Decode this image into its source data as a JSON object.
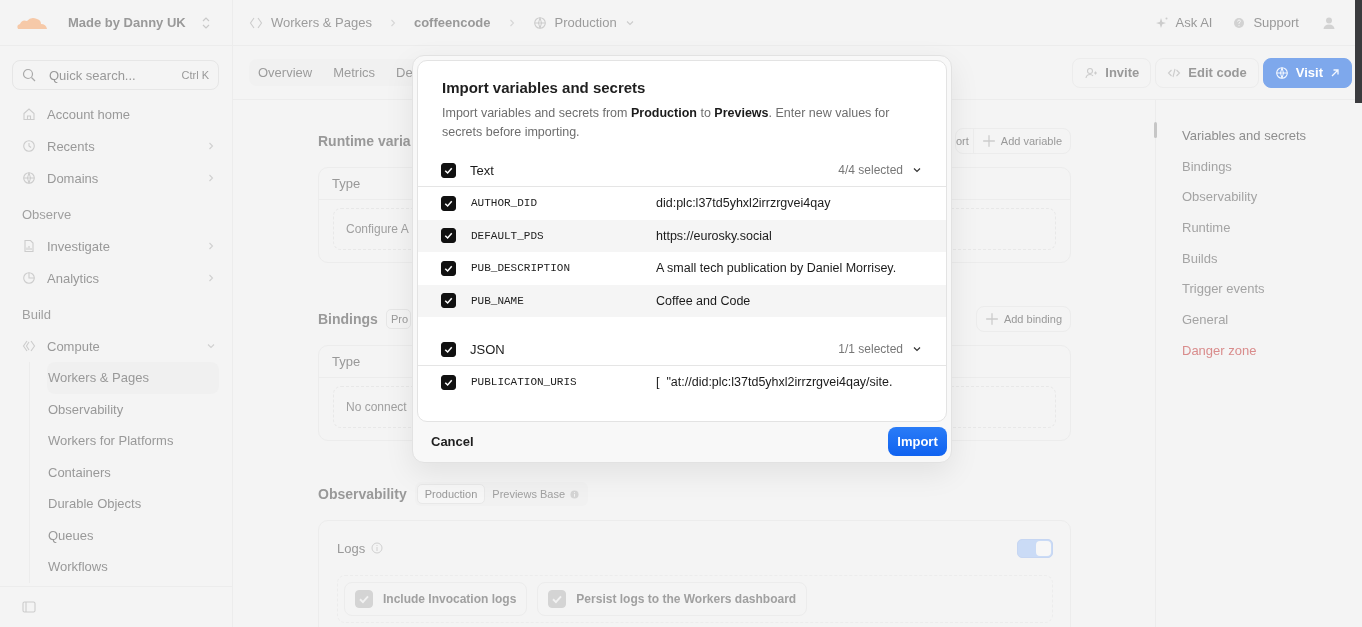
{
  "sidebar": {
    "account": "Made by Danny UK",
    "search": {
      "placeholder": "Quick search...",
      "shortcut": "Ctrl K"
    },
    "sections": [
      {
        "items": [
          {
            "label": "Account home"
          },
          {
            "label": "Recents",
            "expanded": false
          },
          {
            "label": "Domains",
            "expanded": false
          }
        ]
      },
      {
        "title": "Observe",
        "items": [
          {
            "label": "Investigate",
            "expanded": false
          },
          {
            "label": "Analytics",
            "expanded": false
          }
        ]
      },
      {
        "title": "Build",
        "items": [
          {
            "label": "Compute",
            "expanded": true,
            "children": [
              {
                "label": "Workers & Pages",
                "selected": true
              },
              {
                "label": "Observability",
                "selected": false
              },
              {
                "label": "Workers for Platforms",
                "selected": false
              },
              {
                "label": "Containers",
                "selected": false
              },
              {
                "label": "Durable Objects",
                "selected": false
              },
              {
                "label": "Queues",
                "selected": false
              },
              {
                "label": "Workflows",
                "selected": false
              }
            ]
          }
        ]
      }
    ]
  },
  "topbar": {
    "breadcrumb": [
      {
        "label": "Workers & Pages",
        "kind": "link"
      },
      {
        "label": "coffeencode",
        "kind": "current"
      },
      {
        "label": "Production",
        "kind": "dropdown"
      }
    ],
    "actions": [
      {
        "label": "Ask AI",
        "kind": "ai"
      },
      {
        "label": "Support",
        "kind": "help"
      }
    ]
  },
  "tabs": [
    "Overview",
    "Metrics",
    "De"
  ],
  "header_buttons": [
    {
      "label": "Invite",
      "kind": "invite"
    },
    {
      "label": "Edit code",
      "kind": "code"
    },
    {
      "label": "Visit",
      "kind": "primary"
    }
  ],
  "runtime": {
    "title": "Runtime varia",
    "actions": [
      {
        "label": "ort",
        "kind": "plain"
      },
      {
        "label": "Add variable",
        "kind": "add"
      }
    ],
    "table": {
      "column": "Type",
      "empty": "Configure A"
    }
  },
  "bindings": {
    "title": "Bindings",
    "badge": "Pro",
    "actions": [
      {
        "label": "Add binding",
        "kind": "add"
      }
    ],
    "table": {
      "column": "Type",
      "empty": "No connect"
    }
  },
  "observability": {
    "title": "Observability",
    "environments": [
      {
        "label": "Production",
        "selected": true,
        "info": false
      },
      {
        "label": "Previews Base",
        "selected": false,
        "info": true
      }
    ],
    "logs": {
      "title": "Logs",
      "enabled": true,
      "options": [
        {
          "label": "Include Invocation logs",
          "checked": true
        },
        {
          "label": "Persist logs to the Workers dashboard",
          "checked": true
        }
      ]
    }
  },
  "right_nav": [
    {
      "label": "Variables and secrets",
      "selected": true,
      "kind": "normal"
    },
    {
      "label": "Bindings",
      "selected": false,
      "kind": "normal"
    },
    {
      "label": "Observability",
      "selected": false,
      "kind": "normal"
    },
    {
      "label": "Runtime",
      "selected": false,
      "kind": "normal"
    },
    {
      "label": "Builds",
      "selected": false,
      "kind": "normal"
    },
    {
      "label": "Trigger events",
      "selected": false,
      "kind": "normal"
    },
    {
      "label": "General",
      "selected": false,
      "kind": "normal"
    },
    {
      "label": "Danger zone",
      "selected": false,
      "kind": "danger"
    }
  ],
  "dialog": {
    "title": "Import variables and secrets",
    "description": "Import variables and secrets from **Production** to **Previews**. Enter new values for secrets before importing.",
    "groups": [
      {
        "label": "Text",
        "checked": true,
        "count": "4/4 selected",
        "expanded": true,
        "rows": [
          {
            "name": "AUTHOR_DID",
            "value": "did:plc:l37td5yhxl2irrzrgvei4qay",
            "checked": true
          },
          {
            "name": "DEFAULT_PDS",
            "value": "https://eurosky.social",
            "checked": true
          },
          {
            "name": "PUB_DESCRIPTION",
            "value": "A small tech publication by Daniel Morrisey.",
            "checked": true
          },
          {
            "name": "PUB_NAME",
            "value": "Coffee and Code",
            "checked": true
          }
        ]
      },
      {
        "label": "JSON",
        "checked": true,
        "count": "1/1 selected",
        "expanded": true,
        "rows": [
          {
            "name": "PUBLICATION_URIS",
            "value": "[  \"at://did:plc:l37td5yhxl2irrzrgvei4qay/site.",
            "checked": true
          }
        ]
      }
    ],
    "cancel": "Cancel",
    "confirm": "Import"
  }
}
